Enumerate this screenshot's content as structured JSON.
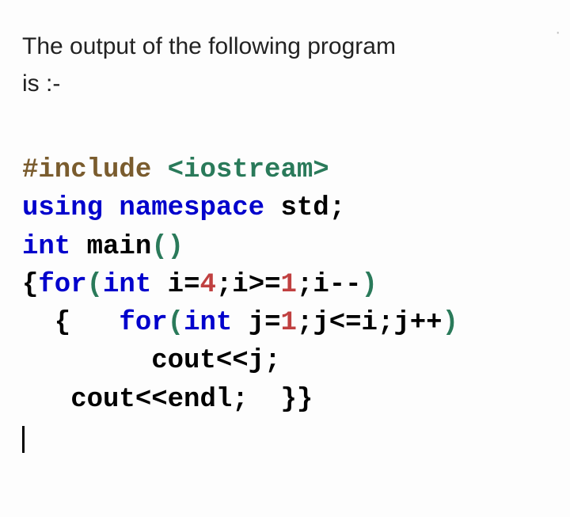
{
  "question": {
    "line1": "The output of the following program",
    "line2": "is :-"
  },
  "code": {
    "l1a": "#include ",
    "l1b": "<iostream>",
    "l2a": "using ",
    "l2b": "namespace ",
    "l2c": "std",
    "l2d": ";",
    "l3a": "int ",
    "l3b": "main",
    "l3c": "()",
    "l4a": "{",
    "l4b": "for",
    "l4c": "(",
    "l4d": "int ",
    "l4e": "i",
    "l4f": "=",
    "l4g": "4",
    "l4h": ";",
    "l4i": "i",
    "l4j": ">=",
    "l4k": "1",
    "l4l": ";",
    "l4m": "i",
    "l4n": "--",
    "l4o": ")",
    "l5a": "  { ",
    "l5b": "  for",
    "l5c": "(",
    "l5d": "int ",
    "l5e": "j",
    "l5f": "=",
    "l5g": "1",
    "l5h": ";",
    "l5i": "j",
    "l5j": "<=",
    "l5k": "i",
    "l5l": ";",
    "l5m": "j",
    "l5n": "++",
    "l5o": ")",
    "l6a": "        cout",
    "l6b": "<<",
    "l6c": "j",
    "l6d": ";",
    "l7a": "   cout",
    "l7b": "<<",
    "l7c": "endl",
    "l7d": ";  ",
    "l7e": "}}"
  }
}
